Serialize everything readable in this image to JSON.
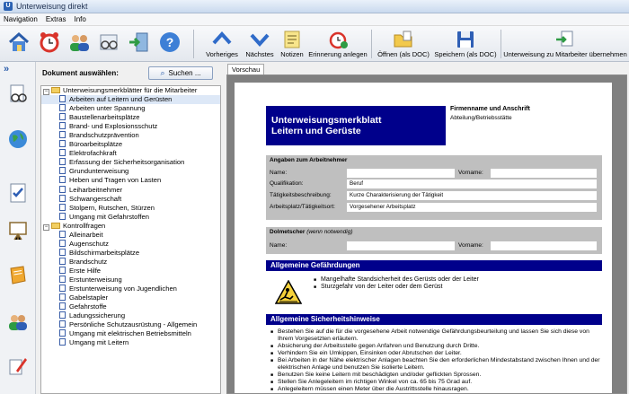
{
  "app": {
    "title": "Unterweisung direkt"
  },
  "menu": [
    "Navigation",
    "Extras",
    "Info"
  ],
  "toolbar": {
    "vorheriges": "Vorheriges",
    "naechstes": "Nächstes",
    "notizen": "Notizen",
    "erinnerung": "Erinnerung anlegen",
    "oeffnen": "Öffnen (als DOC)",
    "speichern": "Speichern (als DOC)",
    "uebernehmen": "Unterweisung zu Mitarbeiter übernehmen"
  },
  "tree_panel": {
    "header": "Dokument auswählen:",
    "search_label": "Suchen ...",
    "group1": "Unterweisungsmerkblätter für die Mitarbeiter",
    "group1_items": [
      "Arbeiten auf Leitern und Gerüsten",
      "Arbeiten unter Spannung",
      "Baustellenarbeitsplätze",
      "Brand- und Explosionsschutz",
      "Brandschutzprävention",
      "Büroarbeitsplätze",
      "Elektrofachkraft",
      "Erfassung der Sicherheitsorganisation",
      "Grundunterweisung",
      "Heben und Tragen von Lasten",
      "Leiharbeitnehmer",
      "Schwangerschaft",
      "Stolpern, Rutschen, Stürzen",
      "Umgang mit Gefahrstoffen"
    ],
    "group2": "Kontrollfragen",
    "group2_items": [
      "Alleinarbeit",
      "Augenschutz",
      "Bildschirmarbeitsplätze",
      "Brandschutz",
      "Erste Hilfe",
      "Erstunterweisung",
      "Erstunterweisung von Jugendlichen",
      "Gabelstapler",
      "Gefahrstoffe",
      "Ladungssicherung",
      "Persönliche Schutzausrüstung - Allgemein",
      "Umgang mit elektrischen Betriebsmitteln",
      "Umgang mit Leitern"
    ]
  },
  "preview": {
    "tab": "Vorschau",
    "doc_title_1": "Unterweisungsmerkblatt",
    "doc_title_2": "Leitern und Gerüste",
    "firma": "Firmenname und Anschrift",
    "abteilung": "Abteilung/Betriebsstätte",
    "angaben_head": "Angaben zum Arbeitnehmer",
    "name_label": "Name:",
    "vorname_label": "Vorname:",
    "qualifikation_label": "Qualifikation:",
    "qualifikation_value": "Beruf",
    "taetigkeit_label": "Tätigkeitsbeschreibung:",
    "taetigkeit_value": "Kurze Charakterisierung der Tätigkeit",
    "arbeitsplatz_label": "Arbeitsplatz/Tätigkeitsort:",
    "arbeitsplatz_value": "Vorgesehener Arbeitsplatz",
    "dolmetscher_head": "Dolmetscher",
    "dolmetscher_note": "(wenn notwendig)",
    "gefaehrdungen_head": "Allgemeine Gefährdungen",
    "gefaehrdungen": [
      "Mangelhafte Standsicherheit des Gerüsts oder der Leiter",
      "Sturzgefahr von der Leiter oder dem Gerüst"
    ],
    "sicherheit_head": "Allgemeine Sicherheitshinweise",
    "sicherheit": [
      "Bestehen Sie auf die für die vorgesehene Arbeit notwendige Gefährdungsbeurteilung und lassen Sie sich diese von Ihrem Vorgesetzten erläutern.",
      "Absicherung der Arbeitsstelle gegen Anfahren und Benutzung durch Dritte.",
      "Verhindern Sie ein Umkippen, Einsinken oder Abrutschen der Leiter.",
      "Bei Arbeiten in der Nähe elektrischer Anlagen beachten Sie den erforderlichen Mindestabstand zwischen Ihnen und der elektrischen Anlage und benutzen Sie isolierte Leitern.",
      "Benutzen Sie keine Leitern mit beschädigten und/oder geflickten Sprossen.",
      "Stellen Sie Anlegeleitern im richtigen Winkel von ca. 65 bis 75 Grad auf.",
      "Anlegeleitern müssen einen Meter über die Austrittsstelle hinausragen."
    ]
  }
}
